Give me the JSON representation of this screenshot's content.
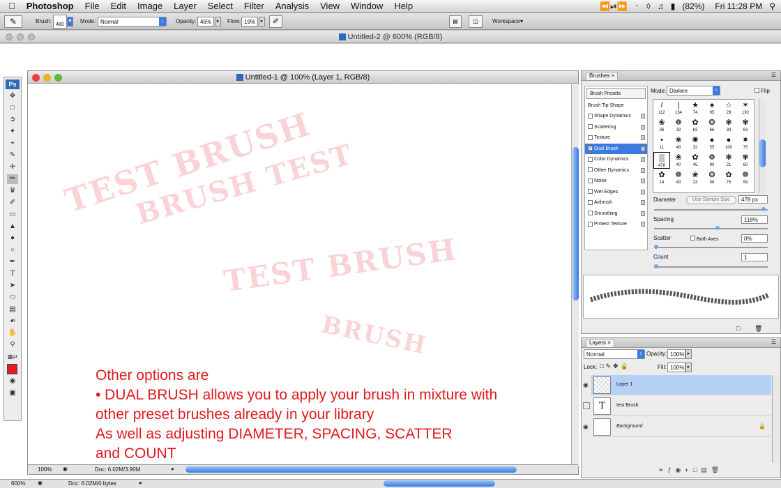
{
  "menubar": {
    "app": "Photoshop",
    "items": [
      "File",
      "Edit",
      "Image",
      "Layer",
      "Select",
      "Filter",
      "Analysis",
      "View",
      "Window",
      "Help"
    ],
    "battery": "(82%)",
    "clock": "Fri 11:28 PM"
  },
  "options": {
    "brush_label": "Brush:",
    "brush_size": "480",
    "mode_label": "Mode:",
    "mode_value": "Normal",
    "opacity_label": "Opacity:",
    "opacity_value": "46%",
    "flow_label": "Flow:",
    "flow_value": "19%",
    "workspace_label": "Workspace"
  },
  "doc2": {
    "title": "Untitled-2 @ 600% (RGB/8)",
    "zoom": "600%",
    "doc_info": "Doc: 6.02M/0 bytes"
  },
  "doc1": {
    "title": "Untitled-1 @ 100% (Layer 1, RGB/8)",
    "zoom": "100%",
    "doc_info": "Doc: 6.02M/3.90M"
  },
  "canvas": {
    "stamps": [
      {
        "text": "TEST BRUSH",
        "size": 46,
        "rot": -18
      },
      {
        "text": "BRUSH TEST",
        "size": 40,
        "rot": -16
      },
      {
        "text": "TEST BRUSH",
        "size": 42,
        "rot": -8
      },
      {
        "text": "BRUSH",
        "size": 34,
        "rot": 12
      }
    ],
    "overlay_lines": [
      "Other options are",
      "• DUAL BRUSH allows you to apply your brush in mixture with",
      "other preset brushes already in your library",
      "As well as adjusting DIAMETER, SPACING, SCATTER",
      "and COUNT"
    ]
  },
  "brushes_panel": {
    "tab": "Brushes",
    "presets_label": "Brush Presets",
    "tip_shape_label": "Brush Tip Shape",
    "options": [
      {
        "label": "Shape Dynamics",
        "checked": false
      },
      {
        "label": "Scattering",
        "checked": false
      },
      {
        "label": "Texture",
        "checked": false
      },
      {
        "label": "Dual Brush",
        "checked": true
      },
      {
        "label": "Color Dynamics",
        "checked": false
      },
      {
        "label": "Other Dynamics",
        "checked": false
      },
      {
        "label": "Noise",
        "checked": false
      },
      {
        "label": "Wet Edges",
        "checked": false
      },
      {
        "label": "Airbrush",
        "checked": false
      },
      {
        "label": "Smoothing",
        "checked": false
      },
      {
        "label": "Protect Texture",
        "checked": false
      }
    ],
    "mode_label": "Mode:",
    "mode_value": "Darken",
    "flip_label": "Flip",
    "sizes": [
      "112",
      "134",
      "74",
      "95",
      "29",
      "192",
      "36",
      "33",
      "63",
      "66",
      "39",
      "63",
      "11",
      "48",
      "32",
      "55",
      "100",
      "75",
      "478",
      "40",
      "45",
      "90",
      "21",
      "60",
      "14",
      "43",
      "23",
      "58",
      "75",
      "59"
    ],
    "diameter_label": "Diameter",
    "use_sample_label": "Use Sample Size",
    "diameter_value": "478 px",
    "spacing_label": "Spacing",
    "spacing_value": "118%",
    "scatter_label": "Scatter",
    "both_axes_label": "Both Axes",
    "scatter_value": "0%",
    "count_label": "Count",
    "count_value": "1"
  },
  "layers_panel": {
    "tab": "Layers",
    "blend_value": "Normal",
    "opacity_label": "Opacity:",
    "opacity_value": "100%",
    "lock_label": "Lock:",
    "fill_label": "Fill:",
    "fill_value": "100%",
    "layers": [
      {
        "name": "Layer 1",
        "selected": true,
        "visible": true
      },
      {
        "name": "test Brush",
        "selected": false,
        "visible": false
      },
      {
        "name": "Background",
        "selected": false,
        "visible": true
      }
    ]
  }
}
